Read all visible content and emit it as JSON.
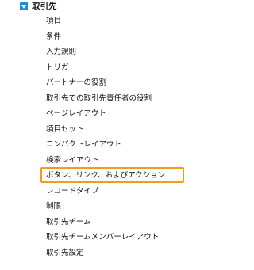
{
  "section": {
    "title": "取引先",
    "toggle_icon": "collapse-triangle-icon",
    "toggle_color": "#1b8fd3",
    "highlight_color": "#f39b1c",
    "items": [
      {
        "label": "項目"
      },
      {
        "label": "条件"
      },
      {
        "label": "入力規則"
      },
      {
        "label": "トリガ"
      },
      {
        "label": "パートナーの役割"
      },
      {
        "label": "取引先での取引先責任者の役割"
      },
      {
        "label": "ページレイアウト"
      },
      {
        "label": "項目セット"
      },
      {
        "label": "コンパクトレイアウト"
      },
      {
        "label": "検索レイアウト"
      },
      {
        "label": "ボタン、リンク、およびアクション",
        "selected": true
      },
      {
        "label": "レコードタイプ"
      },
      {
        "label": "制限"
      },
      {
        "label": "取引先チーム"
      },
      {
        "label": "取引先チームメンバーレイアウト"
      },
      {
        "label": "取引先設定"
      }
    ]
  }
}
